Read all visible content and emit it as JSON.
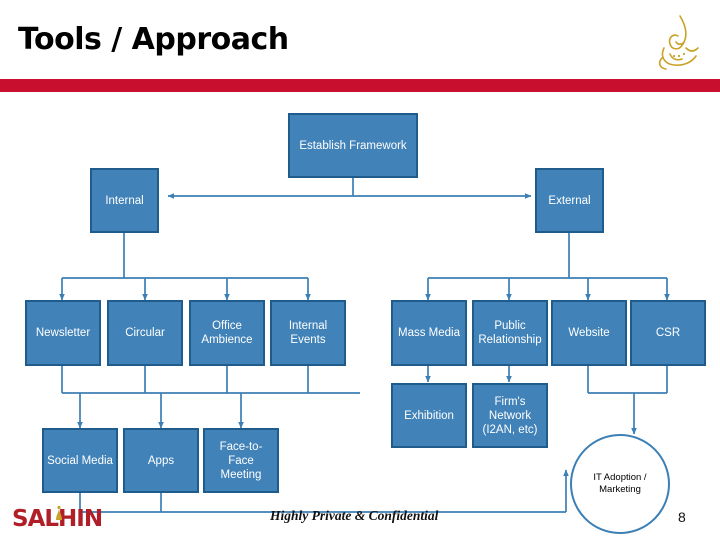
{
  "slide": {
    "title": "Tools / Approach",
    "page_number": "8",
    "confidential_note": "Highly Private & Confidential",
    "accent_red": "#c8102e",
    "node_fill": "#4182b8",
    "node_border": "#1f5c8c",
    "connector_color": "#3b7fb5",
    "logo_text": "SALHIN",
    "logo_color": "#b01f28",
    "emblem_color": "#c9a227"
  },
  "diagram": {
    "root": {
      "label": "Establish Framework"
    },
    "branches": [
      {
        "label": "Internal"
      },
      {
        "label": "External"
      }
    ],
    "internal_tools": [
      {
        "label": "Newsletter"
      },
      {
        "label": "Circular"
      },
      {
        "label": "Office Ambience"
      },
      {
        "label": "Internal Events"
      }
    ],
    "internal_tools_row2": [
      {
        "label": "Social Media"
      },
      {
        "label": "Apps"
      },
      {
        "label": "Face-to-Face Meeting"
      }
    ],
    "external_tools": [
      {
        "label": "Mass Media"
      },
      {
        "label": "Public Relationship"
      },
      {
        "label": "Website"
      },
      {
        "label": "CSR"
      }
    ],
    "external_tools_row2": [
      {
        "label": "Exhibition"
      },
      {
        "label": "Firm's Network (I2AN, etc)"
      }
    ],
    "outcome": {
      "label": "IT Adoption / Marketing"
    }
  }
}
